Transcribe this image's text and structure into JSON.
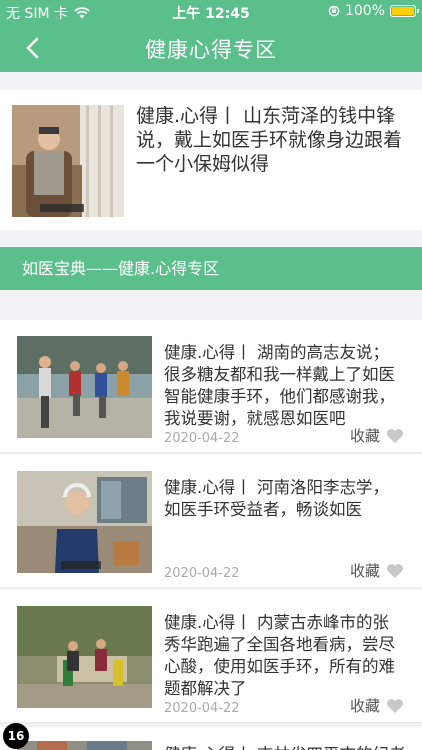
{
  "status_bar": {
    "carrier": "无 SIM 卡",
    "time": "上午 12:45",
    "battery": "100%",
    "battery_level": 1.0
  },
  "nav": {
    "title": "健康心得专区",
    "back_icon": "chevron-left-icon"
  },
  "featured": {
    "text": "健康.心得丨  山东菏泽的钱中锋说，戴上如医手环就像身边跟着一个小保姆似得"
  },
  "section": {
    "title": "如医宝典——健康.心得专区"
  },
  "articles": [
    {
      "text": "健康.心得丨  湖南的高志友说；很多糖友都和我一样戴上了如医智能健康手环，他们都感谢我，我说要谢，就感恩如医吧",
      "date": "2020-04-22",
      "fav_label": "收藏"
    },
    {
      "text": "健康.心得丨  河南洛阳李志学，如医手环受益者，畅谈如医",
      "date": "2020-04-22",
      "fav_label": "收藏"
    },
    {
      "text": "健康.心得丨  内蒙古赤峰市的张秀华跑遍了全国各地看病，尝尽心酸，使用如医手环，所有的难题都解决了",
      "date": "2020-04-22",
      "fav_label": "收藏"
    },
    {
      "text": "健康.心得丨  吉林省四平市的纪老师"
    }
  ],
  "badge": "16",
  "colors": {
    "brand": "#5bbf8c",
    "heart": "#c8c8c8"
  }
}
